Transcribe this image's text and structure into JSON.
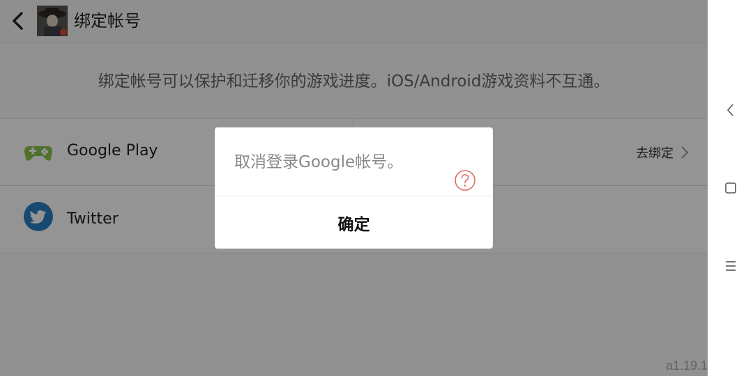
{
  "header": {
    "title": "绑定帐号"
  },
  "notice": "绑定帐号可以保护和迁移你的游戏进度。iOS/Android游戏资料不互通。",
  "accounts": [
    {
      "name": "Google Play",
      "icon": "gamepad-icon",
      "action_label": "去绑定"
    },
    {
      "name": "Twitter",
      "icon": "twitter-bird-icon"
    }
  ],
  "version": "a1.19.1",
  "dialog": {
    "message": "取消登录Google帐号。",
    "confirm_label": "确定",
    "help_icon": "question-circle-icon"
  },
  "system_nav": [
    "back-chevron-icon",
    "square-home-icon",
    "menu-lines-icon"
  ],
  "colors": {
    "google_play_green": "#8bc34a",
    "twitter_blue": "#2a7fc1",
    "help_red": "#e8675b"
  }
}
